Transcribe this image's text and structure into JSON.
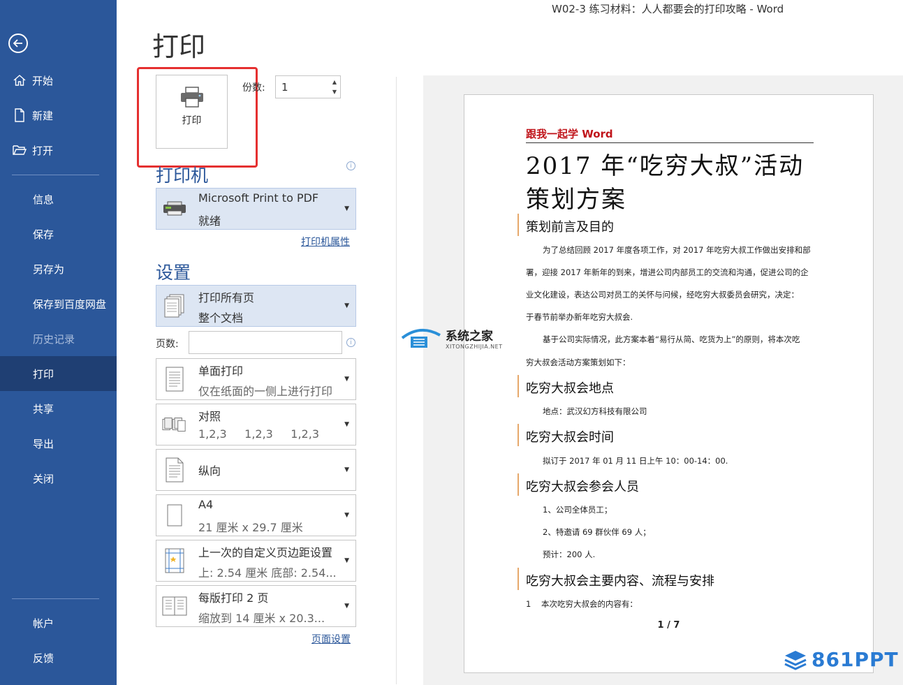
{
  "window": {
    "title": "W02-3 练习材料：人人都要会的打印攻略  -  Word"
  },
  "sidebar": {
    "items": [
      {
        "label": "开始",
        "icon": "home-icon"
      },
      {
        "label": "新建",
        "icon": "new-document-icon"
      },
      {
        "label": "打开",
        "icon": "open-folder-icon"
      },
      {
        "label": "信息"
      },
      {
        "label": "保存"
      },
      {
        "label": "另存为"
      },
      {
        "label": "保存到百度网盘"
      },
      {
        "label": "历史记录",
        "state": "disabled"
      },
      {
        "label": "打印",
        "state": "active"
      },
      {
        "label": "共享"
      },
      {
        "label": "导出"
      },
      {
        "label": "关闭"
      }
    ],
    "bottom_items": [
      {
        "label": "帐户"
      },
      {
        "label": "反馈"
      }
    ]
  },
  "print": {
    "title": "打印",
    "button_label": "打印",
    "copies_label": "份数:",
    "copies_value": "1",
    "printer_heading": "打印机",
    "printer_name": "Microsoft Print to PDF",
    "printer_status": "就绪",
    "printer_properties_link": "打印机属性",
    "settings_heading": "设置",
    "pages_label": "页数:",
    "page_setup_link": "页面设置",
    "settings": [
      {
        "l1": "打印所有页",
        "l2": "整个文档"
      },
      {
        "l1": "单面打印",
        "l2": "仅在纸面的一侧上进行打印"
      },
      {
        "l1": "对照",
        "l2": "1,2,3     1,2,3     1,2,3"
      },
      {
        "l1": "纵向"
      },
      {
        "l1": "A4",
        "l2": "21 厘米 x 29.7 厘米"
      },
      {
        "l1": "上一次的自定义页边距设置",
        "l2": "上: 2.54 厘米 底部: 2.54..."
      },
      {
        "l1": "每版打印 2 页",
        "l2": "缩放到 14 厘米 x 20.3..."
      }
    ]
  },
  "preview": {
    "header": "跟我一起学 Word",
    "title_line1": "2017 年“吃穷大叔”活动",
    "title_line2": "策划方案",
    "h1": "策划前言及目的",
    "p1a": "为了总结回顾 2017 年度各项工作，对 2017 年吃穷大叔工作做出安排和部",
    "p1b": "署，迎接 2017 年新年的到来，增进公司内部员工的交流和沟通，促进公司的企",
    "p1c": "业文化建设，表达公司对员工的关怀与问候，经吃穷大叔委员会研究，决定：",
    "p1d": "于春节前举办新年吃穷大叔会.",
    "p2a": "基于公司实际情况，此方案本着“易行从简、吃货为上”的原则，将本次吃",
    "p2b": "穷大叔会活动方案策划如下：",
    "h2": "吃穷大叔会地点",
    "p3": "地点：武汉幻方科技有限公司",
    "h3": "吃穷大叔会时间",
    "p4": "拟订于 2017 年 01 月 11 日上午 10：00-14：00.",
    "h4": "吃穷大叔会参会人员",
    "p5": "1、公司全体员工；",
    "p6": "2、特邀请 69 群伙伴 69 人；",
    "p7": "预计：200 人.",
    "h5": "吃穷大叔会主要内容、流程与安排",
    "p8": "1    本次吃穷大叔会的内容有：",
    "page_indicator": "1 / 7"
  },
  "watermark": {
    "text1": "系统之家",
    "text2": "XITONGZHIJIA.NET"
  },
  "brand": {
    "text": "861PPT"
  },
  "colors": {
    "sidebar": "#2b579a",
    "sidebar_active": "#1f3f73",
    "accent": "#2b579a",
    "highlight": "#e53030",
    "doc_header": "#c0141a"
  }
}
